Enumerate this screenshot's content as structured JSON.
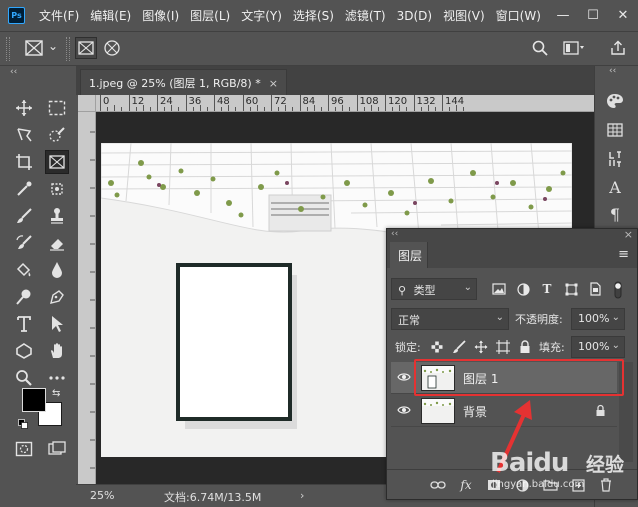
{
  "app": {
    "logo_text": "Ps",
    "brand_color": "#31a8ff"
  },
  "menu": [
    "文件(F)",
    "编辑(E)",
    "图像(I)",
    "图层(L)",
    "文字(Y)",
    "选择(S)",
    "滤镜(T)",
    "3D(D)",
    "视图(V)",
    "窗口(W)"
  ],
  "window_controls": {
    "minimize": "—",
    "maximize": "☐",
    "close": "✕"
  },
  "options_bar": {
    "tool_icon": "frame-tool-icon",
    "dropdown": "⌄"
  },
  "toolbar": {
    "collapse": "‹‹"
  },
  "document": {
    "tab_title": "1.jpeg @ 25% (图层 1, RGB/8) *",
    "tab_close": "×",
    "ruler_h_labels": [
      "0",
      "12",
      "24",
      "36",
      "48",
      "60",
      "72",
      "84",
      "96",
      "108",
      "120",
      "132",
      "144"
    ],
    "zoom": "25%",
    "doc_info": "文档:6.74M/13.5M",
    "status_arrow": "›"
  },
  "right_strip": {
    "collapse": "‹‹"
  },
  "layers_panel": {
    "collapse": "‹‹",
    "close": "×",
    "tab_label": "图层",
    "menu_icon": "≡",
    "filter_label": "类型",
    "blend_mode": "正常",
    "opacity_label": "不透明度:",
    "opacity_value": "100%",
    "lock_label": "锁定:",
    "fill_label": "填充:",
    "fill_value": "100%",
    "layers": [
      {
        "name": "图层 1",
        "selected": true,
        "locked": false
      },
      {
        "name": "背景",
        "selected": false,
        "locked": true
      }
    ],
    "footer_fx": "fx"
  },
  "annotation": {
    "highlight_color": "#e53232"
  },
  "watermark": {
    "logo": "Baidu",
    "text": "经验",
    "url": "jingyan.baidu.com"
  }
}
